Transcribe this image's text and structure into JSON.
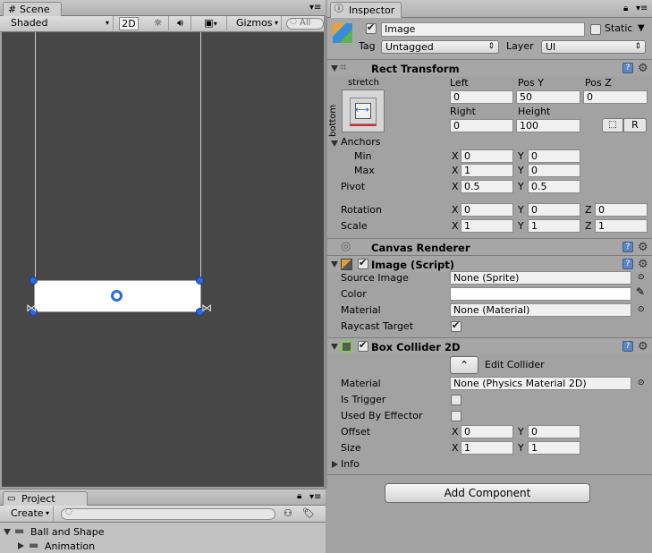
{
  "scene": {
    "tab_label": "Scene",
    "shading_mode": "Shaded",
    "mode_2d": "2D",
    "gizmos_label": "Gizmos",
    "search_placeholder": "All"
  },
  "project": {
    "tab_label": "Project",
    "create_label": "Create",
    "tree": [
      {
        "label": "Ball and Shape"
      },
      {
        "label": "Animation"
      }
    ]
  },
  "inspector": {
    "tab_label": "Inspector",
    "object_name": "Image",
    "active": true,
    "static_label": "Static",
    "static_checked": false,
    "tag_label": "Tag",
    "tag_value": "Untagged",
    "layer_label": "Layer",
    "layer_value": "UI",
    "rect_transform": {
      "title": "Rect Transform",
      "anchor_preset_h": "stretch",
      "anchor_preset_v": "bottom",
      "left_label": "Left",
      "left": "0",
      "posy_label": "Pos Y",
      "posy": "50",
      "posz_label": "Pos Z",
      "posz": "0",
      "right_label": "Right",
      "right": "0",
      "height_label": "Height",
      "height": "100",
      "r_button": "R",
      "anchors_label": "Anchors",
      "min_label": "Min",
      "min_x": "0",
      "min_y": "0",
      "max_label": "Max",
      "max_x": "1",
      "max_y": "0",
      "pivot_label": "Pivot",
      "pivot_x": "0.5",
      "pivot_y": "0.5",
      "rotation_label": "Rotation",
      "rot_x": "0",
      "rot_y": "0",
      "rot_z": "0",
      "scale_label": "Scale",
      "scale_x": "1",
      "scale_y": "1",
      "scale_z": "1",
      "x": "X",
      "y": "Y",
      "z": "Z"
    },
    "canvas_renderer": {
      "title": "Canvas Renderer"
    },
    "image_script": {
      "title": "Image (Script)",
      "enabled": true,
      "source_image_label": "Source Image",
      "source_image": "None (Sprite)",
      "color_label": "Color",
      "color": "#ffffff",
      "material_label": "Material",
      "material": "None (Material)",
      "raycast_label": "Raycast Target",
      "raycast": true
    },
    "box_collider": {
      "title": "Box Collider 2D",
      "enabled": true,
      "edit_collider": "Edit Collider",
      "material_label": "Material",
      "material": "None (Physics Material 2D)",
      "is_trigger_label": "Is Trigger",
      "is_trigger": false,
      "used_by_effector_label": "Used By Effector",
      "used_by_effector": false,
      "offset_label": "Offset",
      "offset_x": "0",
      "offset_y": "0",
      "size_label": "Size",
      "size_x": "1",
      "size_y": "1",
      "info_label": "Info"
    },
    "add_component": "Add Component"
  },
  "colors": {
    "scene_bg": "#474747",
    "panel_bg": "#a2a2a2",
    "selection_blue": "#2a6be0"
  }
}
